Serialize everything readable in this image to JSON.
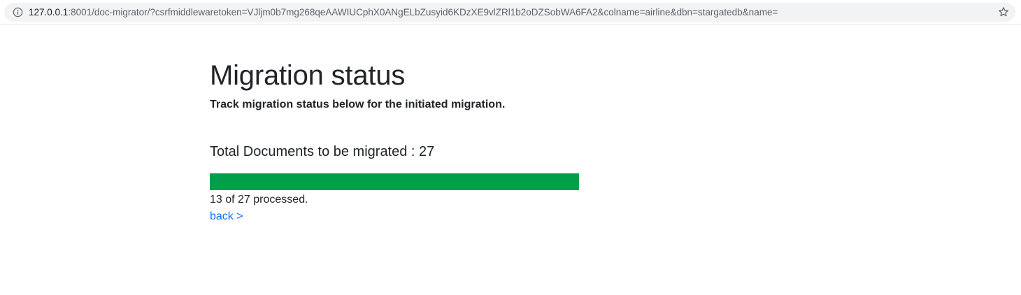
{
  "browser": {
    "url_host": "127.0.0.1",
    "url_rest": ":8001/doc-migrator/?csrfmiddlewaretoken=VJljm0b7mg268qeAAWIUCphX0ANgELbZusyid6KDzXE9vlZRl1b2oDZSobWA6FA2&colname=airline&dbn=stargatedb&name=",
    "info_icon": "info-icon",
    "bookmark_icon": "star-icon"
  },
  "page": {
    "title": "Migration status",
    "subtitle": "Track migration status below for the initiated migration.",
    "total_line": "Total Documents to be migrated : 27",
    "progress": {
      "processed": 13,
      "total": 27,
      "fraction": 1.0,
      "color": "#00a04a"
    },
    "processed_text": "13 of 27 processed.",
    "back_link": "back >"
  },
  "colors": {
    "link": "#0d6efd",
    "text": "#212529",
    "progress_fill": "#00a04a"
  }
}
